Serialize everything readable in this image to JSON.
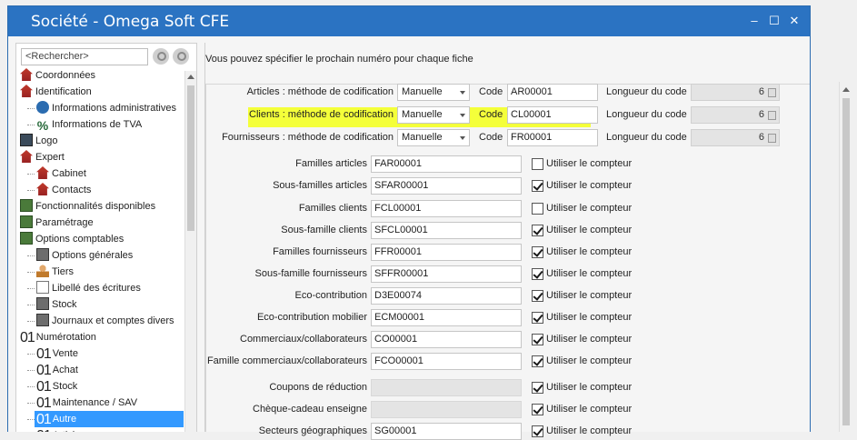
{
  "window": {
    "title": "Société - Omega Soft CFE",
    "minimize": "–",
    "maximize": "☐",
    "close": "✕"
  },
  "sidebar": {
    "search_placeholder": "<Rechercher>",
    "items": [
      {
        "label": "Coordonnées",
        "icon": "house-icon",
        "level": 0
      },
      {
        "label": "Identification",
        "icon": "house-icon",
        "level": 0
      },
      {
        "label": "Informations administratives",
        "icon": "info-icon",
        "level": 1
      },
      {
        "label": "Informations de TVA",
        "icon": "percent-icon",
        "level": 1
      },
      {
        "label": "Logo",
        "icon": "logo-icon",
        "level": 0
      },
      {
        "label": "Expert",
        "icon": "house-icon",
        "level": 0
      },
      {
        "label": "Cabinet",
        "icon": "house-icon",
        "level": 1
      },
      {
        "label": "Contacts",
        "icon": "contact-icon",
        "level": 1
      },
      {
        "label": "Fonctionnalités disponibles",
        "icon": "checklist-icon",
        "level": 0
      },
      {
        "label": "Paramétrage",
        "icon": "settings-icon",
        "level": 0
      },
      {
        "label": "Options comptables",
        "icon": "settings-icon",
        "level": 0
      },
      {
        "label": "Options générales",
        "icon": "box-icon",
        "level": 1
      },
      {
        "label": "Tiers",
        "icon": "user-icon",
        "level": 1
      },
      {
        "label": "Libellé des écritures",
        "icon": "document-icon",
        "level": 1
      },
      {
        "label": "Stock",
        "icon": "box-icon",
        "level": 1
      },
      {
        "label": "Journaux et comptes divers",
        "icon": "box-icon",
        "level": 1
      },
      {
        "label": "Numérotation",
        "icon": "number-icon",
        "level": 0
      },
      {
        "label": "Vente",
        "icon": "number-icon",
        "level": 1
      },
      {
        "label": "Achat",
        "icon": "number-icon",
        "level": 1
      },
      {
        "label": "Stock",
        "icon": "number-icon",
        "level": 1
      },
      {
        "label": "Maintenance / SAV",
        "icon": "number-icon",
        "level": 1
      },
      {
        "label": "Autre",
        "icon": "number-icon",
        "level": 1,
        "selected": true
      },
      {
        "label": "Articles",
        "icon": "number-icon",
        "level": 2
      }
    ],
    "number_glyph": "01"
  },
  "main": {
    "intro": "Vous pouvez spécifier le prochain numéro pour chaque fiche",
    "code_label": "Code",
    "length_label": "Longueur du code",
    "method_rows": [
      {
        "label": "Articles : méthode de codification",
        "method": "Manuelle",
        "code": "AR00001",
        "length": "6"
      },
      {
        "label": "Clients : méthode de codification",
        "method": "Manuelle",
        "code": "CL00001",
        "length": "6"
      },
      {
        "label": "Fournisseurs : méthode de codification",
        "method": "Manuelle",
        "code": "FR00001",
        "length": "6"
      }
    ],
    "counter_label": "Utiliser le compteur",
    "counter_rows": [
      {
        "label": "Familles articles",
        "value": "FAR00001",
        "checked": false
      },
      {
        "label": "Sous-familles articles",
        "value": "SFAR00001",
        "checked": true
      },
      {
        "label": "Familles clients",
        "value": "FCL00001",
        "checked": false
      },
      {
        "label": "Sous-famille clients",
        "value": "SFCL00001",
        "checked": true
      },
      {
        "label": "Familles fournisseurs",
        "value": "FFR00001",
        "checked": true
      },
      {
        "label": "Sous-famille fournisseurs",
        "value": "SFFR00001",
        "checked": true
      },
      {
        "label": "Eco-contribution",
        "value": "D3E00074",
        "checked": true
      },
      {
        "label": "Eco-contribution mobilier",
        "value": "ECM00001",
        "checked": true
      },
      {
        "label": "Commerciaux/collaborateurs",
        "value": "CO00001",
        "checked": true
      },
      {
        "label": "Famille commerciaux/collaborateurs",
        "value": "FCO00001",
        "checked": true
      },
      {
        "label": "Coupons de réduction",
        "value": "",
        "checked": true
      },
      {
        "label": "Chèque-cadeau enseigne",
        "value": "",
        "checked": true
      },
      {
        "label": "Secteurs géographiques",
        "value": "SG00001",
        "checked": true
      }
    ]
  },
  "colors": {
    "titlebar": "#2b73c2",
    "selection": "#3399ff",
    "highlight": "#f4ff3a"
  }
}
